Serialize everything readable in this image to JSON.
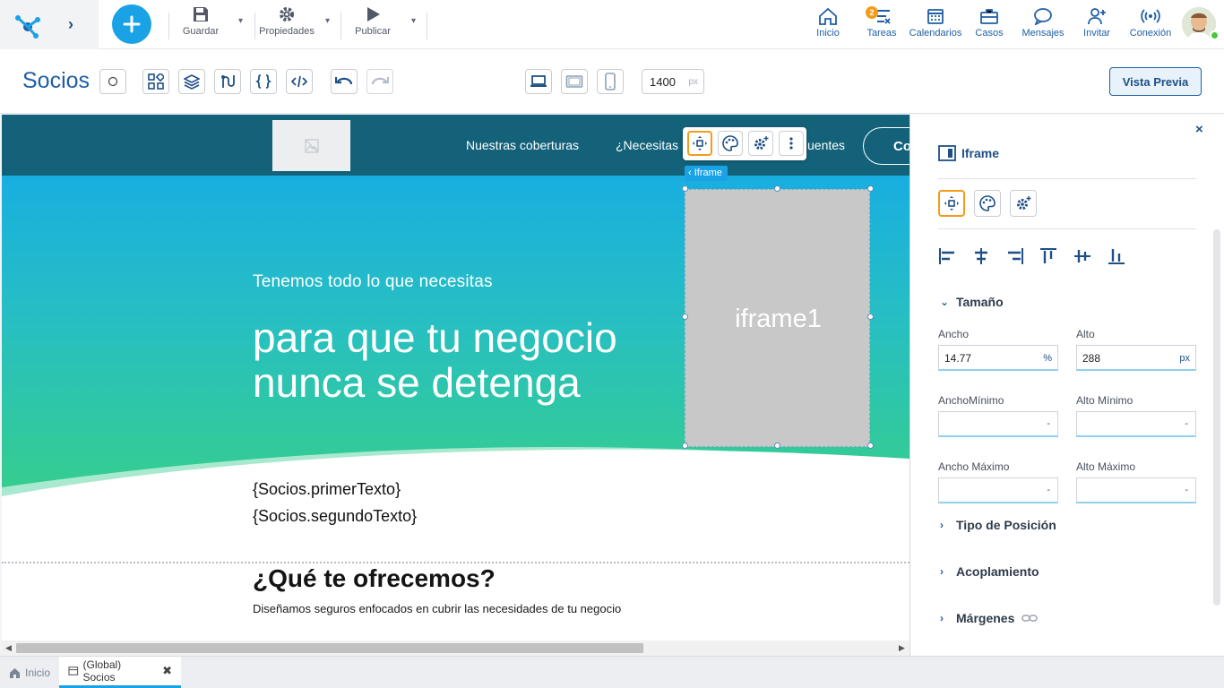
{
  "topbar": {
    "tools": [
      {
        "id": "save",
        "label": "Guardar"
      },
      {
        "id": "props",
        "label": "Propiedades"
      },
      {
        "id": "publish",
        "label": "Publicar"
      }
    ],
    "nav": [
      {
        "id": "home",
        "label": "Inicio"
      },
      {
        "id": "tasks",
        "label": "Tareas",
        "badge": "2"
      },
      {
        "id": "calendars",
        "label": "Calendarios"
      },
      {
        "id": "cases",
        "label": "Casos"
      },
      {
        "id": "messages",
        "label": "Mensajes"
      },
      {
        "id": "invite",
        "label": "Invitar"
      },
      {
        "id": "connection",
        "label": "Conexión"
      }
    ]
  },
  "toolbar": {
    "page_name": "Socios",
    "width_value": "1400",
    "width_unit": "px",
    "preview_label": "Vista Previa"
  },
  "site": {
    "nav_links": [
      "Nuestras coberturas",
      "¿Necesitas",
      "uentes"
    ],
    "nav_cta": "Co",
    "hero_sub": "Tenemos todo lo que necesitas",
    "hero_title_1": "para que tu negocio",
    "hero_title_2": "nunca se detenga",
    "token_1": "{Socios.primerTexto}",
    "token_2": "{Socios.segundoTexto}",
    "offer_title": "¿Qué te ofrecemos?",
    "offer_sub": "Diseñamos seguros enfocados en cubrir las necesidades de tu negocio"
  },
  "selection": {
    "tag": "Iframe",
    "label": "iframe1"
  },
  "panel": {
    "title": "Iframe",
    "size_section": "Tamaño",
    "width_label": "Ancho",
    "width_value": "14.77",
    "width_unit": "%",
    "height_label": "Alto",
    "height_value": "288",
    "height_unit": "px",
    "min_width_label": "AnchoMínimo",
    "min_height_label": "Alto Mínimo",
    "max_width_label": "Ancho Máximo",
    "max_height_label": "Alto Máximo",
    "empty_value": "-",
    "sections": [
      "Tipo de Posición",
      "Acoplamiento",
      "Márgenes"
    ]
  },
  "bottom_tabs": [
    {
      "label": "Inicio"
    },
    {
      "label": "(Global) Socios"
    }
  ],
  "colors": {
    "accent": "#1aa2e6",
    "brand_dark": "#1f4f86",
    "highlight": "#f39c19",
    "site_nav": "#13627a"
  }
}
